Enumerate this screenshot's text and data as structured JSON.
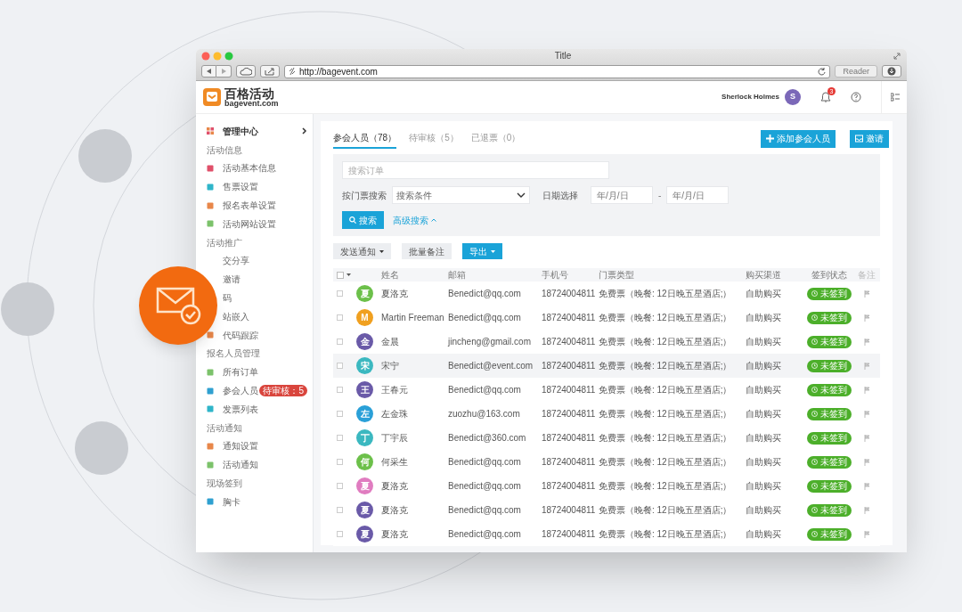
{
  "browser": {
    "title": "Title",
    "url": "http://bagevent.com",
    "reader": "Reader"
  },
  "app_header": {
    "logo_name": "百格活动",
    "logo_domain": "bagevent.com",
    "user_name": "Sherlock Holmes",
    "user_initial": "S",
    "notification_count": "3"
  },
  "sidebar": {
    "header": "管理中心",
    "groups": [
      {
        "title": "活动信息",
        "items": [
          {
            "label": "活动基本信息",
            "color": "#e0506a"
          },
          {
            "label": "售票设置",
            "color": "#2fb5c9"
          },
          {
            "label": "报名表单设置",
            "color": "#e8874a"
          },
          {
            "label": "活动网站设置",
            "color": "#7cc26b"
          }
        ]
      },
      {
        "title": "活动推广",
        "items": [
          {
            "label": "交分享"
          },
          {
            "label": "邀请"
          },
          {
            "label": "码"
          },
          {
            "label": "站嵌入"
          },
          {
            "label": "代码跟踪",
            "color": "#e8874a"
          }
        ]
      },
      {
        "title": "报名人员管理",
        "items": [
          {
            "label": "所有订单",
            "color": "#7cc26b"
          },
          {
            "label": "参会人员",
            "color": "#2fa0d0",
            "badge": "待审核：5"
          },
          {
            "label": "发票列表",
            "color": "#2fb5c9"
          }
        ]
      },
      {
        "title": "活动通知",
        "items": [
          {
            "label": "通知设置",
            "color": "#e8874a"
          },
          {
            "label": "活动通知",
            "color": "#7cc26b"
          }
        ]
      },
      {
        "title": "现场签到",
        "items": [
          {
            "label": "胸卡",
            "color": "#2fa0d0"
          }
        ]
      }
    ]
  },
  "tabs": [
    {
      "label": "参会人员（78）",
      "selected": true
    },
    {
      "label": "待审核（5）",
      "selected": false
    },
    {
      "label": "已退票（0）",
      "selected": false
    }
  ],
  "actions": [
    {
      "label": "添加参会人员",
      "kind": "add"
    },
    {
      "label": "邀请",
      "kind": "invite"
    }
  ],
  "filters": {
    "search_placeholder": "搜索订单",
    "ticket_label": "按门票搜索",
    "ticket_select": "搜索条件",
    "date_label": "日期选择",
    "date_from": "年/月/日",
    "date_separator": "-",
    "date_to": "年/月/日",
    "search_button": "搜索",
    "advanced_link": "高级搜索"
  },
  "toolbar": [
    {
      "label": "发送通知",
      "kind": "dropdown"
    },
    {
      "label": "批量备注",
      "kind": "plain"
    },
    {
      "label": "导出",
      "kind": "primary"
    }
  ],
  "table": {
    "select_all_checked": false,
    "columns": [
      "姓名",
      "邮箱",
      "手机号",
      "门票类型",
      "购买渠道",
      "签到状态",
      "备注"
    ],
    "rows": [
      {
        "initial": "夏",
        "color": "#6cc04a",
        "name": "夏洛克",
        "email": "Benedict@qq.com",
        "phone": "18724004811",
        "ticket": "免费票（晚餐: 12日晚五星酒店;）",
        "channel": "自助购买",
        "status": "未签到",
        "selected": false
      },
      {
        "initial": "M",
        "color": "#f0a020",
        "name": "Martin Freeman",
        "email": "Benedict@qq.com",
        "phone": "18724004811",
        "ticket": "免费票（晚餐: 12日晚五星酒店;）",
        "channel": "自助购买",
        "status": "未签到",
        "selected": false
      },
      {
        "initial": "金",
        "color": "#6a5aa8",
        "name": "金晨",
        "email": "jincheng@gmail.com",
        "phone": "18724004811",
        "ticket": "免费票（晚餐: 12日晚五星酒店;）",
        "channel": "自助购买",
        "status": "未签到",
        "selected": false
      },
      {
        "initial": "宋",
        "color": "#3bb8c0",
        "name": "宋宁",
        "email": "Benedict@event.com",
        "phone": "18724004811",
        "ticket": "免费票（晚餐: 12日晚五星酒店;）",
        "channel": "自助购买",
        "status": "未签到",
        "selected": true
      },
      {
        "initial": "王",
        "color": "#6a5aa8",
        "name": "王春元",
        "email": "Benedict@qq.com",
        "phone": "18724004811",
        "ticket": "免费票（晚餐: 12日晚五星酒店;）",
        "channel": "自助购买",
        "status": "未签到",
        "selected": false
      },
      {
        "initial": "左",
        "color": "#2aa0d8",
        "name": "左金珠",
        "email": "zuozhu@163.com",
        "phone": "18724004811",
        "ticket": "免费票（晚餐: 12日晚五星酒店;）",
        "channel": "自助购买",
        "status": "未签到",
        "selected": false
      },
      {
        "initial": "丁",
        "color": "#3bb8c0",
        "name": "丁宇辰",
        "email": "Benedict@360.com",
        "phone": "18724004811",
        "ticket": "免费票（晚餐: 12日晚五星酒店;）",
        "channel": "自助购买",
        "status": "未签到",
        "selected": false
      },
      {
        "initial": "何",
        "color": "#6cc04a",
        "name": "何采生",
        "email": "Benedict@qq.com",
        "phone": "18724004811",
        "ticket": "免费票（晚餐: 12日晚五星酒店;）",
        "channel": "自助购买",
        "status": "未签到",
        "selected": false
      },
      {
        "initial": "夏",
        "color": "#e07cc0",
        "name": "夏洛克",
        "email": "Benedict@qq.com",
        "phone": "18724004811",
        "ticket": "免费票（晚餐: 12日晚五星酒店;）",
        "channel": "自助购买",
        "status": "未签到",
        "selected": false
      },
      {
        "initial": "夏",
        "color": "#6a5aa8",
        "name": "夏洛克",
        "email": "Benedict@qq.com",
        "phone": "18724004811",
        "ticket": "免费票（晚餐: 12日晚五星酒店;）",
        "channel": "自助购买",
        "status": "未签到",
        "selected": false
      },
      {
        "initial": "夏",
        "color": "#6a5aa8",
        "name": "夏洛克",
        "email": "Benedict@qq.com",
        "phone": "18724004811",
        "ticket": "免费票（晚餐: 12日晚五星酒店;）",
        "channel": "自助购买",
        "status": "未签到",
        "selected": false
      }
    ]
  }
}
